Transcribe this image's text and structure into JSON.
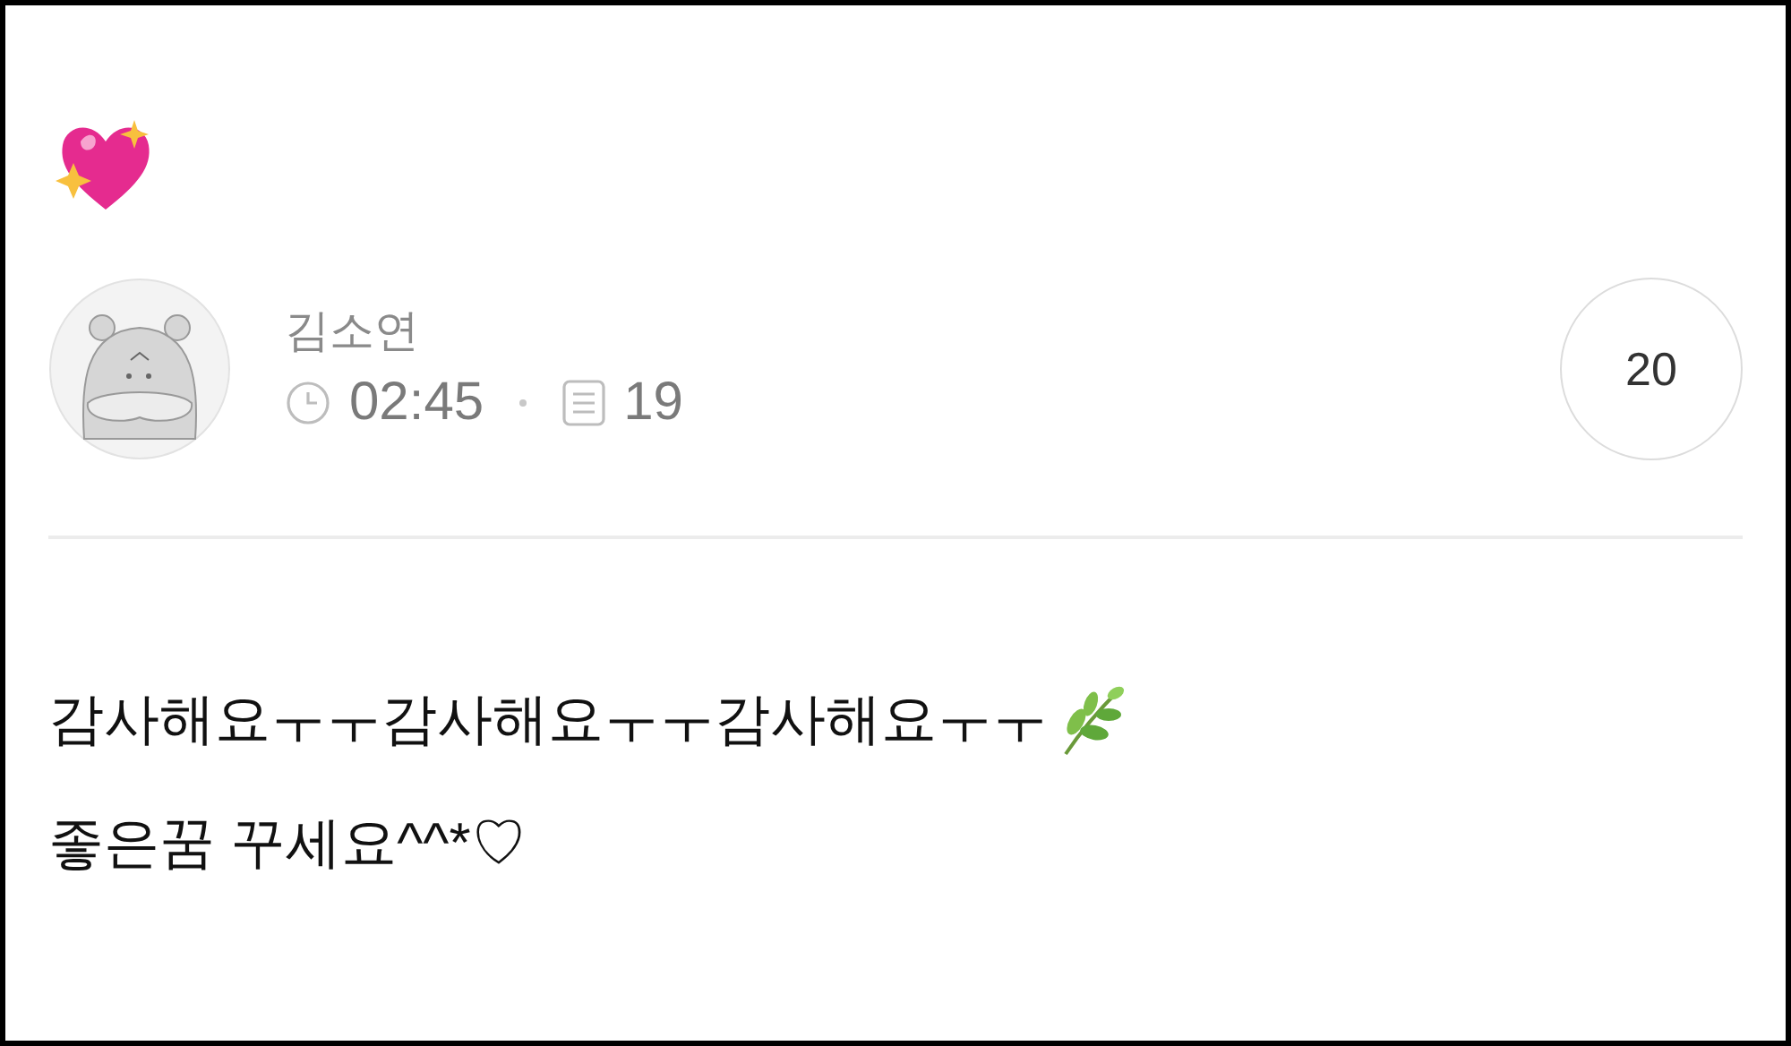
{
  "author": {
    "name": "김소연",
    "time": "02:45",
    "post_count": "19"
  },
  "reply_count": "20",
  "comment": {
    "lines": [
      "감사해요ㅜㅜ감사해요ㅜㅜ감사해요ㅜㅜ",
      "좋은꿈 꾸세요^^*♡"
    ]
  }
}
